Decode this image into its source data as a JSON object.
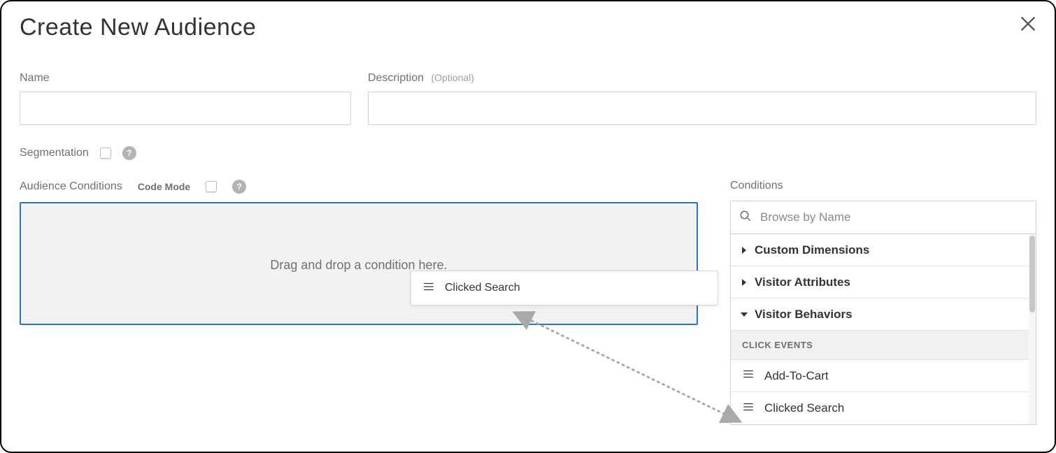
{
  "dialog": {
    "title": "Create New Audience"
  },
  "fields": {
    "name_label": "Name",
    "description_label": "Description",
    "description_optional": "(Optional)",
    "segmentation_label": "Segmentation"
  },
  "audience": {
    "label": "Audience Conditions",
    "code_mode_label": "Code Mode",
    "drop_hint": "Drag and drop a condition here."
  },
  "help_glyph": "?",
  "drag_item": {
    "label": "Clicked Search"
  },
  "panel": {
    "label": "Conditions",
    "search_placeholder": "Browse by Name",
    "categories": {
      "custom_dimensions": "Custom Dimensions",
      "visitor_attributes": "Visitor Attributes",
      "visitor_behaviors": "Visitor Behaviors"
    },
    "behaviors_section_label": "CLICK EVENTS",
    "click_events": {
      "add_to_cart": "Add-To-Cart",
      "clicked_search": "Clicked Search"
    }
  }
}
